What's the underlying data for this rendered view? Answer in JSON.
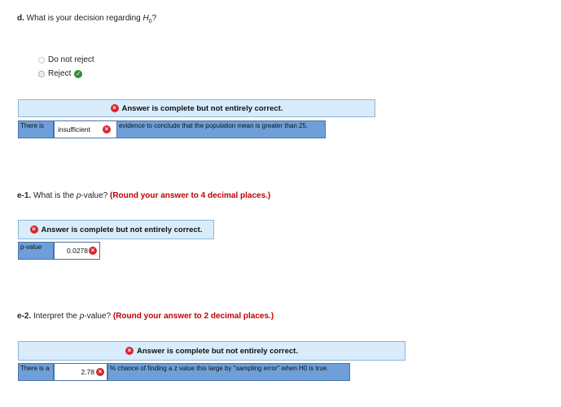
{
  "part_d": {
    "label": "d.",
    "question": "What is your decision regarding ",
    "h": "H",
    "sub": "0",
    "qmark": "?",
    "options": [
      {
        "label": "Do not reject",
        "selected": false
      },
      {
        "label": "Reject",
        "selected": true,
        "correct": true
      }
    ],
    "banner": "Answer is complete but not entirely correct.",
    "row": {
      "lead": "There is",
      "answer": "insufficient",
      "trail": "evidence to conclude that the population mean is greater than 25."
    }
  },
  "part_e1": {
    "label": "e-1.",
    "question_pre": "What is the ",
    "question_var": "p",
    "question_post": "-value?",
    "instruction": "(Round your answer to 4 decimal places.)",
    "banner": "Answer is complete but not entirely correct.",
    "row": {
      "lead": "p-value",
      "answer": "0.0278"
    }
  },
  "part_e2": {
    "label": "e-2.",
    "question_pre": "Interpret the ",
    "question_var": "p",
    "question_post": "-value?",
    "instruction": "(Round your answer to 2 decimal places.)",
    "banner": "Answer is complete but not entirely correct.",
    "row": {
      "lead": "There is a",
      "answer": "2.78",
      "trail": "% chance of finding a z value this large by \"sampling error\" when H0 is true."
    }
  },
  "icons": {
    "incorrect": "x-circle-icon",
    "correct": "check-circle-icon"
  },
  "colors": {
    "banner_bg": "#d9ecfb",
    "cell_blue": "#6f9fd8",
    "error_red": "#d8262d",
    "ok_green": "#2e8b3e",
    "instruction_red": "#c00000"
  }
}
